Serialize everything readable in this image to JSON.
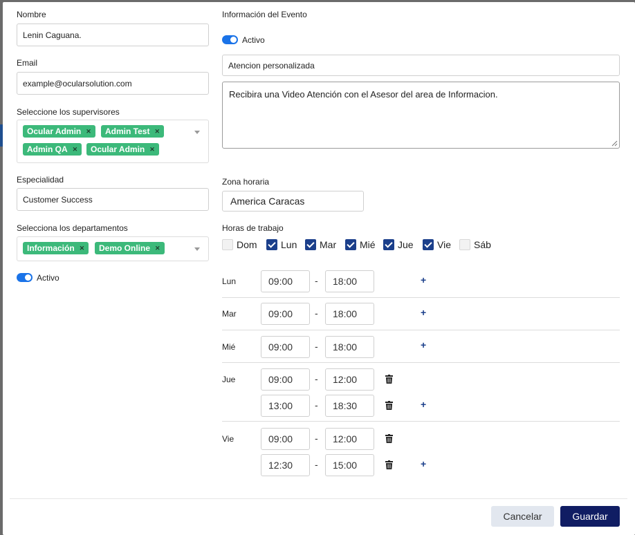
{
  "left": {
    "nombre": {
      "label": "Nombre",
      "value": "Lenin Caguana."
    },
    "email": {
      "label": "Email",
      "value": "example@ocularsolution.com"
    },
    "supervisores": {
      "label": "Seleccione los supervisores",
      "tags": [
        "Ocular Admin",
        "Admin Test",
        "Admin QA",
        "Ocular Admin"
      ]
    },
    "especialidad": {
      "label": "Especialidad",
      "value": "Customer Success"
    },
    "departamentos": {
      "label": "Selecciona los departamentos",
      "tags": [
        "Información",
        "Demo Online"
      ]
    },
    "activo": {
      "label": "Activo",
      "on": true
    }
  },
  "right": {
    "evento": {
      "label": "Información del Evento",
      "activo_label": "Activo",
      "title_value": "Atencion personalizada",
      "description": "Recibira una Video Atención con el Asesor del area de Informacion."
    },
    "zona": {
      "label": "Zona horaria",
      "value": "America Caracas"
    },
    "horas": {
      "label": "Horas de trabajo",
      "days": [
        {
          "label": "Dom",
          "checked": false
        },
        {
          "label": "Lun",
          "checked": true
        },
        {
          "label": "Mar",
          "checked": true
        },
        {
          "label": "Mié",
          "checked": true
        },
        {
          "label": "Jue",
          "checked": true
        },
        {
          "label": "Vie",
          "checked": true
        },
        {
          "label": "Sáb",
          "checked": false
        }
      ]
    },
    "schedule": [
      {
        "day": "Lun",
        "slots": [
          {
            "from": "09:00",
            "to": "18:00"
          }
        ]
      },
      {
        "day": "Mar",
        "slots": [
          {
            "from": "09:00",
            "to": "18:00"
          }
        ]
      },
      {
        "day": "Mié",
        "slots": [
          {
            "from": "09:00",
            "to": "18:00"
          }
        ]
      },
      {
        "day": "Jue",
        "slots": [
          {
            "from": "09:00",
            "to": "12:00"
          },
          {
            "from": "13:00",
            "to": "18:30"
          }
        ]
      },
      {
        "day": "Vie",
        "slots": [
          {
            "from": "09:00",
            "to": "12:00"
          },
          {
            "from": "12:30",
            "to": "15:00"
          }
        ]
      }
    ],
    "dash": "-",
    "plus": "+"
  },
  "footer": {
    "cancel": "Cancelar",
    "save": "Guardar"
  },
  "colors": {
    "tag": "#3cb97a",
    "toggle": "#1a73e8",
    "checkbox": "#1b3f8b",
    "save_button": "#101d63",
    "cancel_button": "#e2e7ef"
  }
}
